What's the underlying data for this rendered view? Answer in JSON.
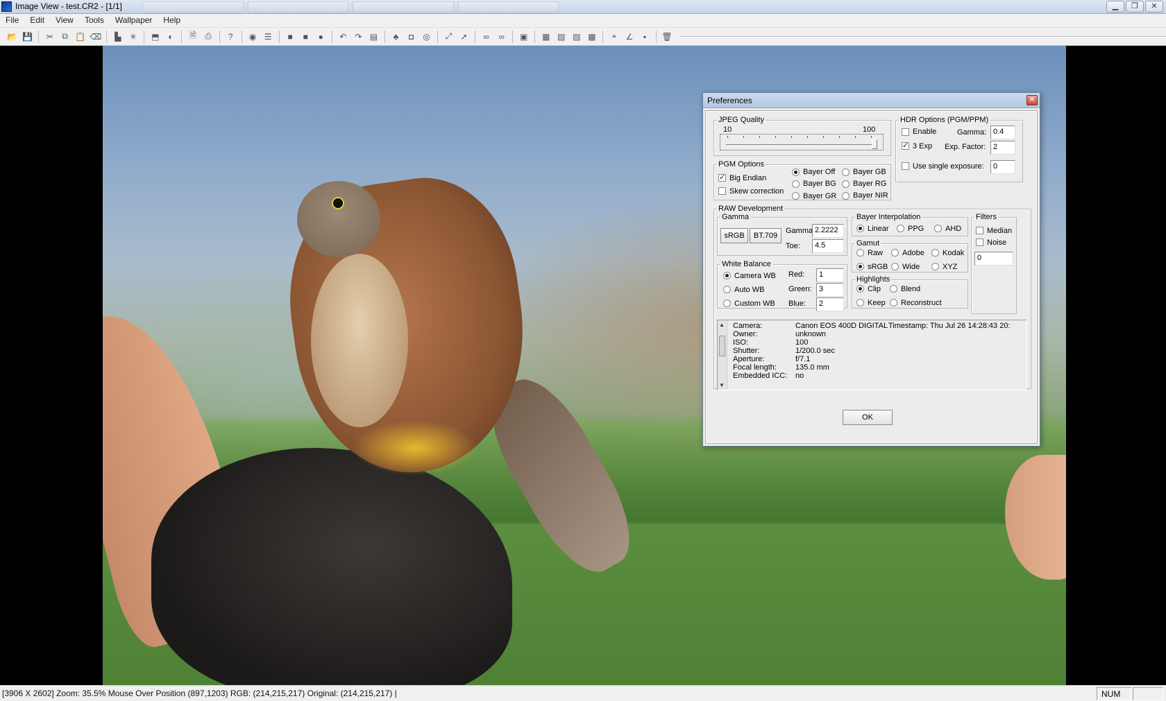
{
  "window": {
    "title": "Image View - test.CR2 - [1/1]",
    "buttons": {
      "minimize": "▁",
      "maximize": "❐",
      "close": "✕"
    }
  },
  "menu": [
    "File",
    "Edit",
    "View",
    "Tools",
    "Wallpaper",
    "Help"
  ],
  "toolbar_icons": [
    "open-folder-icon",
    "save-icon",
    "sep",
    "cut-icon",
    "copy-icon",
    "paste-icon",
    "delete-icon",
    "sep",
    "histogram-icon",
    "crosshair-icon",
    "sep",
    "resize-icon",
    "contrast-icon",
    "sep",
    "print-preview-icon",
    "print-icon",
    "sep",
    "help-icon",
    "sep",
    "color-icon",
    "properties-icon",
    "sep",
    "square-icon",
    "stop-icon",
    "record-icon",
    "sep",
    "rotate-left-icon",
    "rotate-right-icon",
    "page-icon",
    "sep",
    "tree-icon",
    "car-icon",
    "disc-icon",
    "sep",
    "zoom-fit-icon",
    "pointer-icon",
    "sep",
    "binoculars-icon",
    "binoculars-down-icon",
    "sep",
    "stamp-icon",
    "sep",
    "tool-a-icon",
    "tool-b-icon",
    "tool-c-icon",
    "tool-d-icon",
    "sep",
    "target-icon",
    "angle-icon",
    "square-small-icon",
    "sep",
    "trash-icon"
  ],
  "status": {
    "text": "[3906 X  2602] Zoom: 35.5% Mouse Over Position (897,1203) RGB: (214,215,217)  Original: (214,215,217)  |",
    "num": "NUM"
  },
  "dialog": {
    "title": "Preferences",
    "jpeg": {
      "legend": "JPEG Quality",
      "min_label": "10",
      "max_label": "100",
      "value": 100
    },
    "hdr": {
      "legend": "HDR Options (PGM/PPM)",
      "enable_label": "Enable",
      "enable_checked": false,
      "three_exp_label": "3 Exp",
      "three_exp_checked": true,
      "gamma_label": "Gamma:",
      "gamma_value": "0.4",
      "exp_factor_label": "Exp. Factor:",
      "exp_factor_value": "2",
      "single_exposure_label": "Use single exposure:",
      "single_exposure_checked": false,
      "single_exposure_value": "0"
    },
    "pgm": {
      "legend": "PGM Options",
      "big_endian_label": "Big Endian",
      "big_endian_checked": true,
      "skew_label": "Skew correction",
      "skew_checked": false,
      "bayer_options": [
        "Bayer Off",
        "Bayer GB",
        "Bayer BG",
        "Bayer RG",
        "Bayer GR",
        "Bayer NIR"
      ],
      "bayer_selected": "Bayer Off"
    },
    "raw": {
      "legend": "RAW Development",
      "gamma": {
        "legend": "Gamma",
        "srgb_button": "sRGB",
        "bt709_button": "BT.709",
        "gamma_label": "Gamma:",
        "gamma_value": "2.2222",
        "toe_label": "Toe:",
        "toe_value": "4.5"
      },
      "interpolation": {
        "legend": "Bayer Interpolation",
        "options": [
          "Linear",
          "PPG",
          "AHD"
        ],
        "selected": "Linear"
      },
      "filters": {
        "legend": "Filters",
        "median_label": "Median",
        "median_checked": false,
        "noise_label": "Noise",
        "noise_checked": false,
        "noise_value": "0"
      },
      "white_balance": {
        "legend": "White Balance",
        "options": [
          "Camera WB",
          "Auto WB",
          "Custom WB"
        ],
        "selected": "Camera WB",
        "red_label": "Red:",
        "red_value": "1",
        "green_label": "Green:",
        "green_value": "3",
        "blue_label": "Blue:",
        "blue_value": "2"
      },
      "gamut": {
        "legend": "Gamut",
        "options": [
          "Raw",
          "Adobe",
          "Kodak",
          "sRGB",
          "Wide",
          "XYZ"
        ],
        "selected": "sRGB"
      },
      "highlights": {
        "legend": "Highlights",
        "options": [
          "Clip",
          "Blend",
          "Keep",
          "Reconstruct"
        ],
        "selected": "Clip"
      }
    },
    "info": {
      "rows": [
        {
          "label": "Camera:",
          "value": "Canon EOS 400D DIGITAL",
          "extra": "Timestamp: Thu Jul 26 14:28:43 20:"
        },
        {
          "label": "Owner:",
          "value": "unknown",
          "extra": ""
        },
        {
          "label": "ISO:",
          "value": "100",
          "extra": ""
        },
        {
          "label": "Shutter:",
          "value": "1/200.0 sec",
          "extra": ""
        },
        {
          "label": "Aperture:",
          "value": "f/7.1",
          "extra": ""
        },
        {
          "label": "Focal length:",
          "value": "135.0 mm",
          "extra": ""
        },
        {
          "label": "Embedded ICC:",
          "value": "no",
          "extra": ""
        }
      ]
    },
    "ok_button": "OK"
  }
}
